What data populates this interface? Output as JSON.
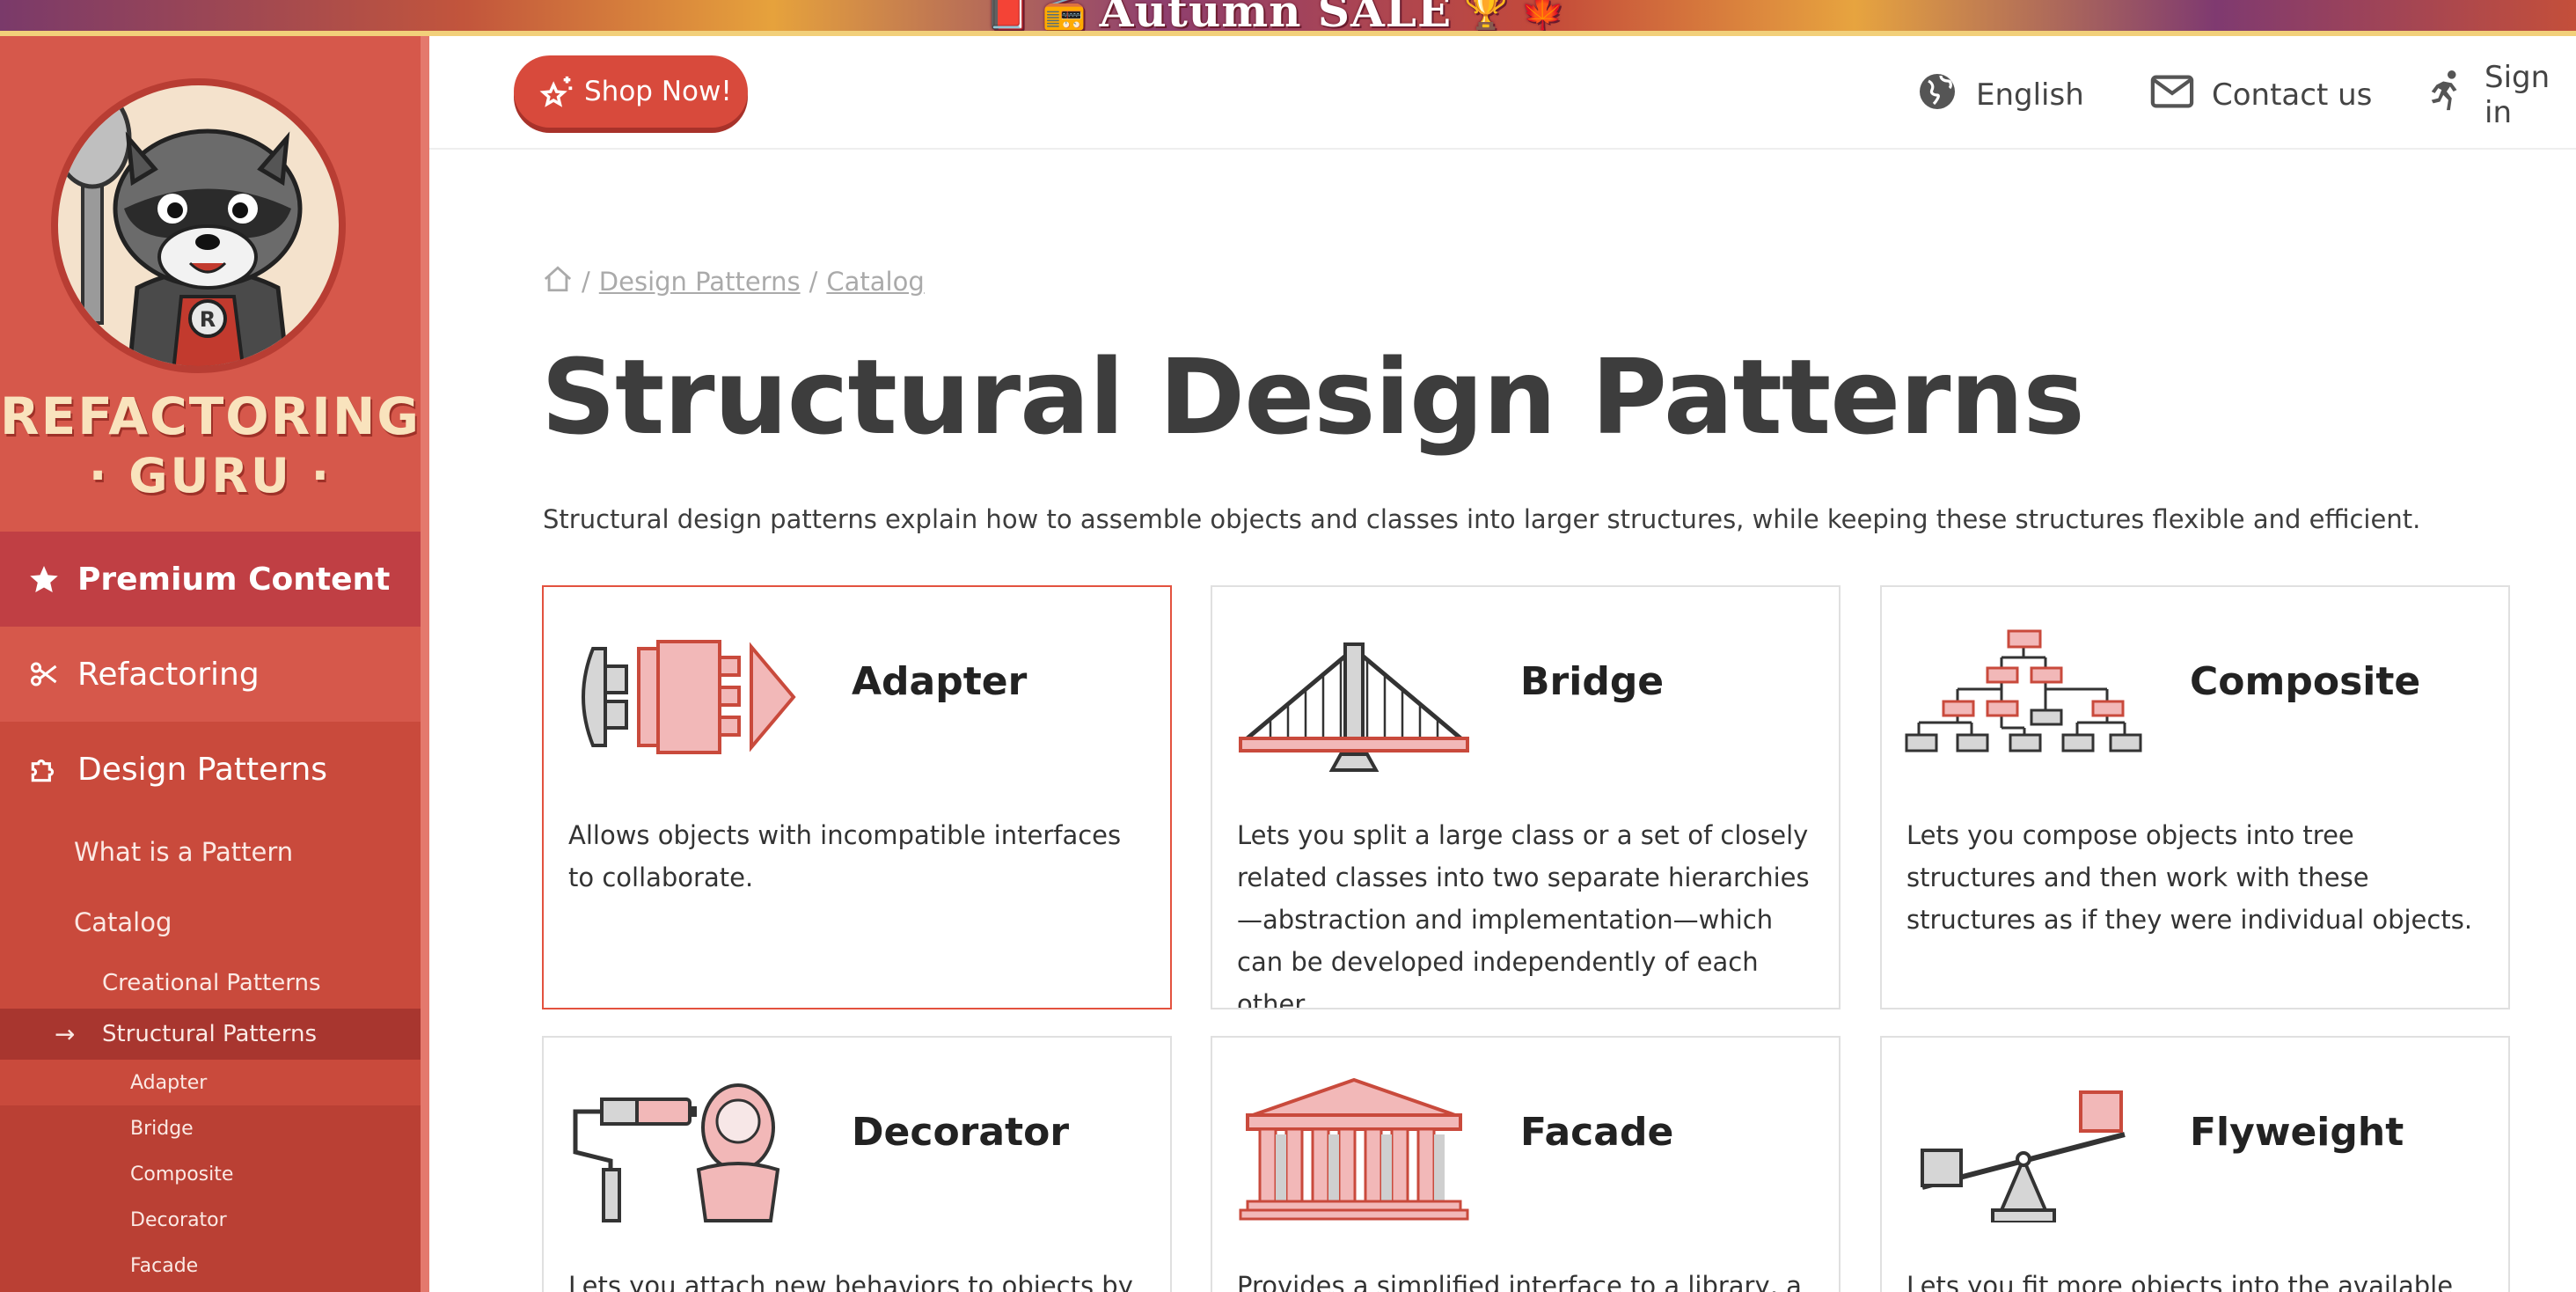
{
  "banner": {
    "text": "Autumn SALE"
  },
  "brand": {
    "line1": "REFACTORING",
    "line2": "· GURU ·"
  },
  "sidebar": {
    "main": [
      {
        "label": "Premium Content",
        "icon": "star-icon"
      },
      {
        "label": "Refactoring",
        "icon": "scissors-icon"
      },
      {
        "label": "Design Patterns",
        "icon": "puzzle-icon"
      }
    ],
    "sub": [
      {
        "label": "What is a Pattern"
      },
      {
        "label": "Catalog"
      }
    ],
    "catalog": [
      {
        "label": "Creational Patterns"
      },
      {
        "label": "Structural Patterns",
        "active": true
      }
    ],
    "structural": [
      {
        "label": "Adapter"
      },
      {
        "label": "Bridge"
      },
      {
        "label": "Composite"
      },
      {
        "label": "Decorator"
      },
      {
        "label": "Facade"
      }
    ]
  },
  "header": {
    "shop_label": "Shop Now!",
    "language_label": "English",
    "contact_label": "Contact us",
    "signin_label": "Sign in"
  },
  "breadcrumb": {
    "sep": "/",
    "items": [
      "Design Patterns",
      "Catalog"
    ]
  },
  "page": {
    "title": "Structural Design Patterns",
    "description": "Structural design patterns explain how to assemble objects and classes into larger structures, while keeping these structures flexible and efficient."
  },
  "cards": [
    {
      "name": "Adapter",
      "description": "Allows objects with incompatible interfaces to collaborate."
    },
    {
      "name": "Bridge",
      "description": "Lets you split a large class or a set of closely related classes into two separate hierarchies—abstraction and implementation—which can be developed independently of each other."
    },
    {
      "name": "Composite",
      "description": "Lets you compose objects into tree structures and then work with these structures as if they were individual objects."
    },
    {
      "name": "Decorator",
      "description": "Lets you attach new behaviors to objects by"
    },
    {
      "name": "Facade",
      "description": "Provides a simplified interface to a library, a"
    },
    {
      "name": "Flyweight",
      "description": "Lets you fit more objects into the available"
    }
  ],
  "colors": {
    "brand": "#c94a3c",
    "accent": "#e3523f",
    "text": "#3d3d3d"
  }
}
